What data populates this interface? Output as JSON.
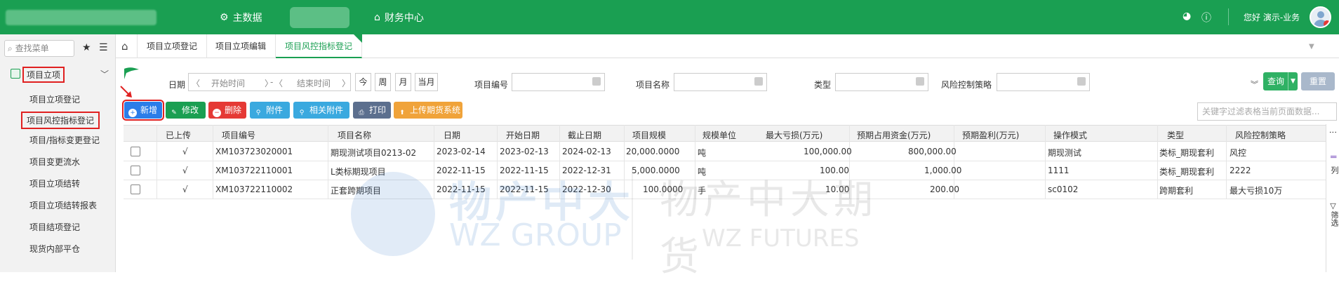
{
  "topbar": {
    "nav1": "主数据",
    "nav2": "财务中心",
    "greeting": "您好 演示-业务"
  },
  "sidebar": {
    "search_placeholder": "查找菜单",
    "group": "项目立项",
    "items": [
      "项目立项登记",
      "项目风控指标登记",
      "项目/指标变更登记",
      "项目变更流水",
      "项目立项结转",
      "项目立项结转报表",
      "项目结项登记",
      "现货内部平仓"
    ]
  },
  "tabs": [
    "项目立项登记",
    "项目立项编辑",
    "项目风控指标登记"
  ],
  "filters": {
    "date_label": "日期",
    "start_placeholder": "开始时间",
    "end_placeholder": "结束时间",
    "sep": "-",
    "quick": [
      "今",
      "周",
      "月",
      "当月"
    ],
    "project_no_label": "项目编号",
    "project_name_label": "项目名称",
    "type_label": "类型",
    "risk_label": "风险控制策略",
    "query": "查询",
    "reset": "重置"
  },
  "toolbar": {
    "add": "新增",
    "edit": "修改",
    "delete": "删除",
    "attach": "附件",
    "related": "相关附件",
    "print": "打印",
    "upload": "上传期货系统",
    "filter_placeholder": "关键字过滤表格当前页面数据..."
  },
  "table": {
    "headers": [
      "已上传",
      "项目编号",
      "项目名称",
      "日期",
      "开始日期",
      "截止日期",
      "项目规模",
      "规模单位",
      "最大亏损(万元)",
      "预期占用资金(万元)",
      "预期盈利(万元)",
      "操作模式",
      "类型",
      "风险控制策略"
    ],
    "rows": [
      [
        "√",
        "XM103723020001",
        "期现测试项目0213-02",
        "2023-02-14",
        "2023-02-13",
        "2024-02-13",
        "20,000.0000",
        "吨",
        "100,000.00",
        "800,000.00",
        "",
        "期现测试",
        "类标_期现套利",
        "风控"
      ],
      [
        "√",
        "XM103722110001",
        "L类标期现项目",
        "2022-11-15",
        "2022-11-15",
        "2022-12-31",
        "5,000.0000",
        "吨",
        "100.00",
        "1,000.00",
        "",
        "1111",
        "类标_期现套利",
        "2222"
      ],
      [
        "√",
        "XM103722110002",
        "正套跨期项目",
        "2022-11-15",
        "2022-11-15",
        "2022-12-30",
        "100.0000",
        "手",
        "10.00",
        "200.00",
        "",
        "sc0102",
        "跨期套利",
        "最大亏损10万"
      ]
    ]
  },
  "rightbar": {
    "cols": "列",
    "filter": "筛选"
  },
  "watermark": {
    "cn1": "物产中大",
    "en1": "WZ GROUP",
    "cn2": "物产中大期货",
    "en2": "WZ FUTURES"
  }
}
